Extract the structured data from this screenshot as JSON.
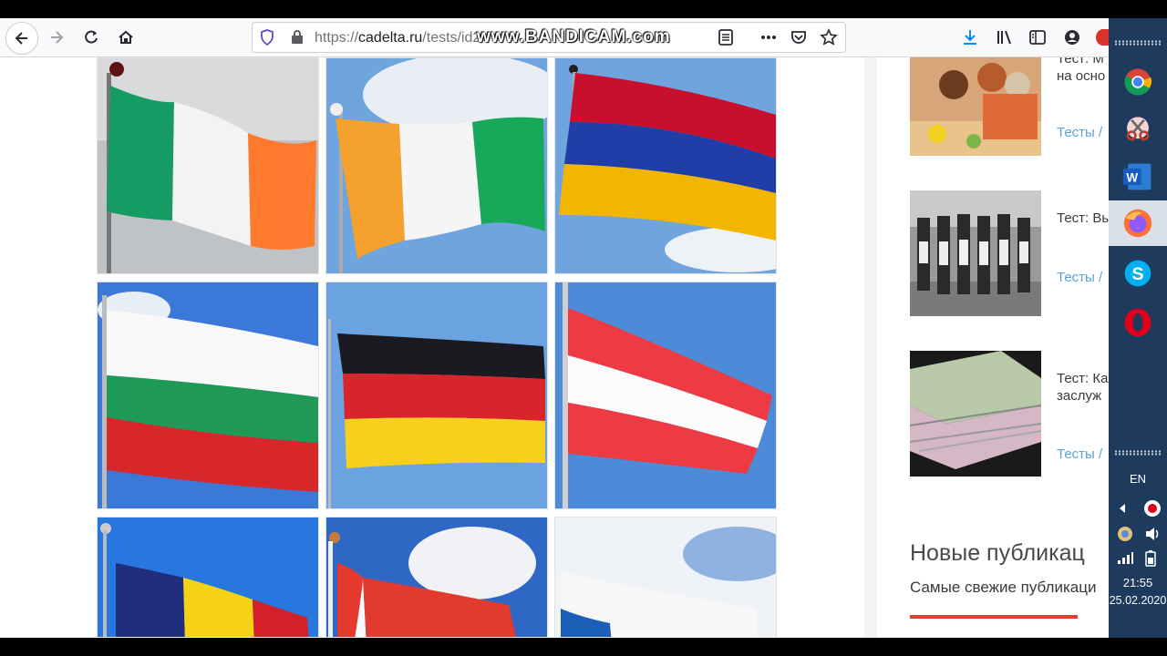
{
  "browser": {
    "url_prefix": "https://",
    "url_host": "cadelta.ru",
    "url_path": "/tests/id2",
    "watermark": "www.BANDICAM.com"
  },
  "icons": {
    "back": "arrow-left-icon",
    "forward": "arrow-right-icon",
    "reload": "reload-icon",
    "home": "home-icon",
    "shield": "shield-icon",
    "lock": "lock-icon",
    "reader": "reader-view-icon",
    "more": "more-icon",
    "pocket": "pocket-icon",
    "bookmark": "star-icon",
    "download": "download-icon",
    "library": "library-icon",
    "sidebar": "sidebar-icon",
    "account": "account-icon"
  },
  "flags": [
    {
      "name": "Ireland",
      "colors": [
        "#169b62",
        "#ffffff",
        "#ff883e"
      ]
    },
    {
      "name": "Ivory Coast",
      "colors": [
        "#f77f00",
        "#ffffff",
        "#009e60"
      ]
    },
    {
      "name": "Armenia",
      "colors": [
        "#d90012",
        "#0033a0",
        "#f2a800"
      ]
    },
    {
      "name": "Bulgaria",
      "colors": [
        "#ffffff",
        "#00966e",
        "#d62612"
      ]
    },
    {
      "name": "Germany",
      "colors": [
        "#000000",
        "#dd0000",
        "#ffce00"
      ]
    },
    {
      "name": "Austria",
      "colors": [
        "#ed2939",
        "#ffffff",
        "#ed2939"
      ]
    },
    {
      "name": "Romania",
      "colors": [
        "#002b7f",
        "#fcd116",
        "#ce1126"
      ]
    },
    {
      "name": "Peru",
      "colors": [
        "#d91023",
        "#ffffff",
        "#d91023"
      ]
    },
    {
      "name": "Slovenia",
      "colors": [
        "#ffffff",
        "#005da4",
        "#ed1c24"
      ]
    }
  ],
  "sidebar": {
    "articles": [
      {
        "title_line1": "Тест: М",
        "title_line2": "на осно",
        "category": "Тесты /"
      },
      {
        "title_line1": "Тест: Вы",
        "title_line2": "",
        "category": "Тесты /"
      },
      {
        "title_line1": "Тест: Ка",
        "title_line2": "заслуж",
        "category": "Тесты /"
      }
    ],
    "new_publications_title": "Новые публикац",
    "new_publications_subtitle": "Самые свежие публикаци"
  },
  "taskbar": {
    "apps": [
      "chrome-icon",
      "snipping-tool-icon",
      "word-icon",
      "firefox-icon",
      "skype-icon",
      "opera-icon"
    ],
    "language": "EN",
    "time": "21:55",
    "date": "25.02.2020"
  },
  "colors": {
    "accent": "#d9432c",
    "link": "#5aa4d6",
    "taskbar": "#1e3a5c"
  }
}
